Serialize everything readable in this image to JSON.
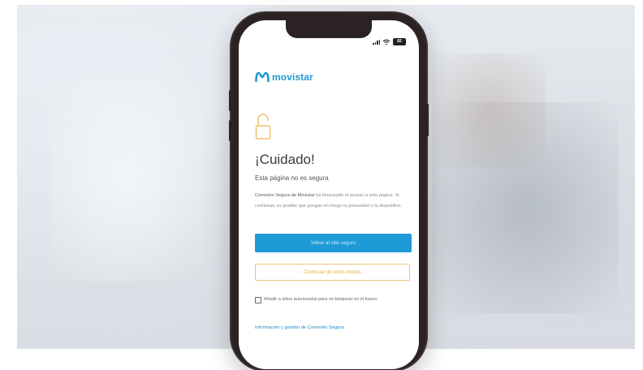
{
  "brand": {
    "name": "movistar",
    "color": "#1e9ad6"
  },
  "status_bar": {
    "battery": "82",
    "signal_icon": "signal-bars-icon",
    "wifi_icon": "wifi-icon"
  },
  "warning": {
    "icon": "unlocked-padlock-icon",
    "title": "¡Cuidado!",
    "subtitle": "Esta página no es segura",
    "body_bold": "Conexión Segura de Movistar",
    "body_rest": " ha bloqueado el acceso a esta página. Si continúas, es posible que pongas en riesgo tu privacidad o tu dispositivo."
  },
  "actions": {
    "primary_label": "Volver al sitio seguro",
    "secondary_label": "Continuar de todos modos"
  },
  "options": {
    "whitelist_label": "Añadir a sitios autorizados para no bloquear en el futuro.",
    "whitelist_checked": false
  },
  "footer": {
    "link_label": "Información y gestión de Conexión Segura"
  },
  "colors": {
    "accent": "#1e9ad6",
    "warning": "#e6ad45",
    "phone_frame": "#2b2224"
  }
}
